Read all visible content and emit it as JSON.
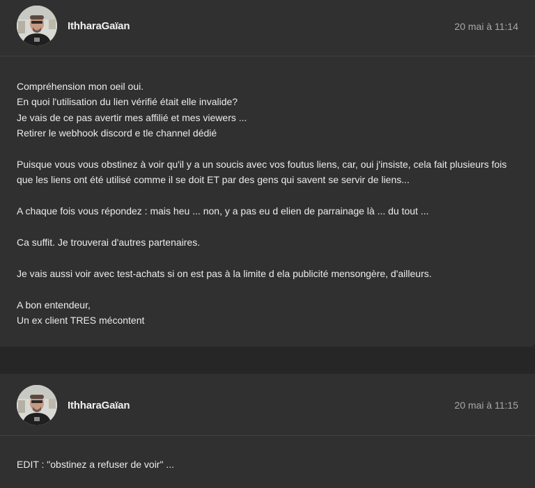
{
  "posts": [
    {
      "author": "IthharaGaïan",
      "timestamp": "20 mai à 11:14",
      "paragraphs": [
        "Compréhension mon oeil oui.\nEn quoi l'utilisation du lien vérifié était elle invalide?\nJe vais de ce pas avertir mes affilié et mes viewers ...\nRetirer le webhook discord e tle channel dédié",
        "Puisque vous vous obstinez à voir qu'il y a un soucis avec vos foutus liens, car, oui j'insiste, cela fait plusieurs fois\nque les liens ont été utilisé comme il se doit ET par des gens qui savent se servir de liens...",
        "A chaque fois vous répondez : mais heu ... non, y a pas eu d elien de parrainage là ... du tout ...",
        "Ca suffit. Je trouverai d'autres partenaires.",
        "Je vais aussi voir avec test-achats si on est pas à la limite d ela publicité mensongère, d'ailleurs.",
        "A bon entendeur,\nUn ex client TRES mécontent"
      ]
    },
    {
      "author": "IthharaGaïan",
      "timestamp": "20 mai à 11:15",
      "paragraphs": [
        "EDIT : \"obstinez a refuser de voir\" ..."
      ]
    }
  ]
}
